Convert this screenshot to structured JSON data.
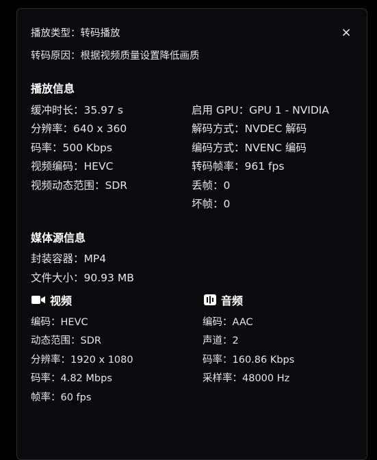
{
  "header": {
    "play_type_label": "播放类型",
    "play_type_value": "转码播放",
    "reason_label": "转码原因",
    "reason_value": "根据视频质量设置降低画质",
    "close_glyph": "×"
  },
  "playback": {
    "title": "播放信息",
    "left": [
      {
        "label": "缓冲时长",
        "value": "35.97 s"
      },
      {
        "label": "分辨率",
        "value": "640 x 360"
      },
      {
        "label": "码率",
        "value": "500 Kbps"
      },
      {
        "label": "视频编码",
        "value": "HEVC"
      },
      {
        "label": "视频动态范围",
        "value": "SDR"
      }
    ],
    "right": [
      {
        "label": "启用 GPU",
        "value": "GPU 1 - NVIDIA"
      },
      {
        "label": "解码方式",
        "value": "NVDEC 解码"
      },
      {
        "label": "编码方式",
        "value": "NVENC 编码"
      },
      {
        "label": "转码帧率",
        "value": "961 fps"
      },
      {
        "label": "丢帧",
        "value": "0"
      },
      {
        "label": "坏帧",
        "value": "0"
      }
    ]
  },
  "media": {
    "title": "媒体源信息",
    "container_label": "封装容器",
    "container_value": "MP4",
    "size_label": "文件大小",
    "size_value": "90.93 MB",
    "video": {
      "title": "视频",
      "icon": "video-camera-icon",
      "rows": [
        {
          "label": "编码",
          "value": "HEVC"
        },
        {
          "label": "动态范围",
          "value": "SDR"
        },
        {
          "label": "分辨率",
          "value": "1920 x 1080"
        },
        {
          "label": "码率",
          "value": "4.82 Mbps"
        },
        {
          "label": "帧率",
          "value": "60 fps"
        }
      ]
    },
    "audio": {
      "title": "音频",
      "icon": "audio-waveform-icon",
      "rows": [
        {
          "label": "编码",
          "value": "AAC"
        },
        {
          "label": "声道",
          "value": "2"
        },
        {
          "label": "码率",
          "value": "160.86 Kbps"
        },
        {
          "label": "采样率",
          "value": "48000 Hz"
        }
      ]
    }
  }
}
